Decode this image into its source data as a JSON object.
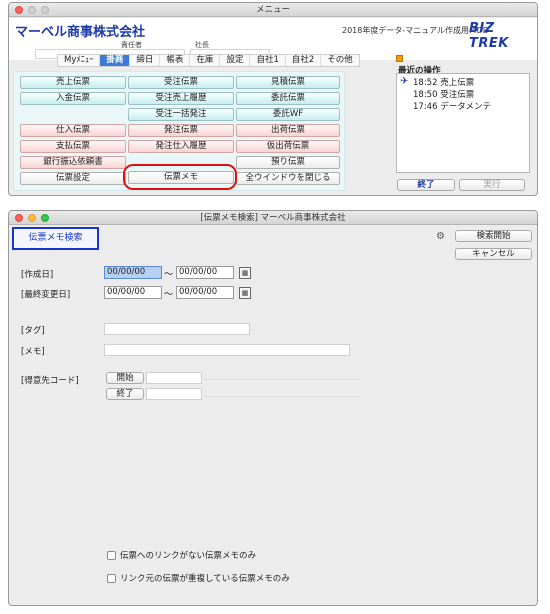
{
  "menu_window": {
    "title": "メニュー",
    "company": "マーベル商事株式会社",
    "edition": "2018年度データ-マニュアル作成用.4DD",
    "logo": "BIZ TREK",
    "manager_label": "責任者",
    "president_label": "社長",
    "tabs": [
      "Myﾒﾆｭｰ",
      "掛商",
      "締日",
      "帳表",
      "在庫",
      "設定",
      "自社1",
      "自社2",
      "その他"
    ],
    "active_tab": "掛商",
    "buttons": {
      "sales_slip": "売上伝票",
      "order_slip": "受注伝票",
      "quote_slip": "見積伝票",
      "deposit_slip": "入金伝票",
      "order_sales_history": "受注売上履歴",
      "consign_slip": "委託伝票",
      "order_bulk_place": "受注一括発注",
      "consign_wf": "委託WF",
      "purchase_slip": "仕入伝票",
      "place_order_slip": "発注伝票",
      "shipment_slip": "出荷伝票",
      "payment_slip": "支払伝票",
      "place_purchase_history": "発注仕入履歴",
      "temp_shipment_slip": "仮出荷伝票",
      "bank_transfer_request": "銀行振込依頼書",
      "deposit_hold_slip": "預り伝票",
      "slip_settings": "伝票設定",
      "slip_memo": "伝票メモ",
      "close_all_windows": "全ウインドウを閉じる"
    },
    "recent": {
      "title": "最近の操作",
      "items": [
        "18:52 売上伝票",
        "18:50 受注伝票",
        "17:46 データメンテ"
      ]
    },
    "end_button": "終了",
    "execute_button": "実行"
  },
  "search_window": {
    "title": "[伝票メモ検索] マーベル商事株式会社",
    "label": "伝票メモ検索",
    "search_start": "検索開始",
    "cancel": "キャンセル",
    "created_date_label": "[作成日]",
    "modified_date_label": "[最終変更日]",
    "created_from": "00/00/00",
    "created_to": "00/00/00",
    "modified_from": "00/00/00",
    "modified_to": "00/00/00",
    "tilde": "〜",
    "calendar_glyph": "▦",
    "tag_label": "[タグ]",
    "memo_label": "[メモ]",
    "customer_code_label": "[得意先コード]",
    "start_button": "開始",
    "end_button": "終了",
    "checkbox_no_link": "伝票へのリンクがない伝票メモのみ",
    "checkbox_duplicate": "リンク元の伝票が重複している伝票メモのみ",
    "selected_field": "created_from"
  }
}
